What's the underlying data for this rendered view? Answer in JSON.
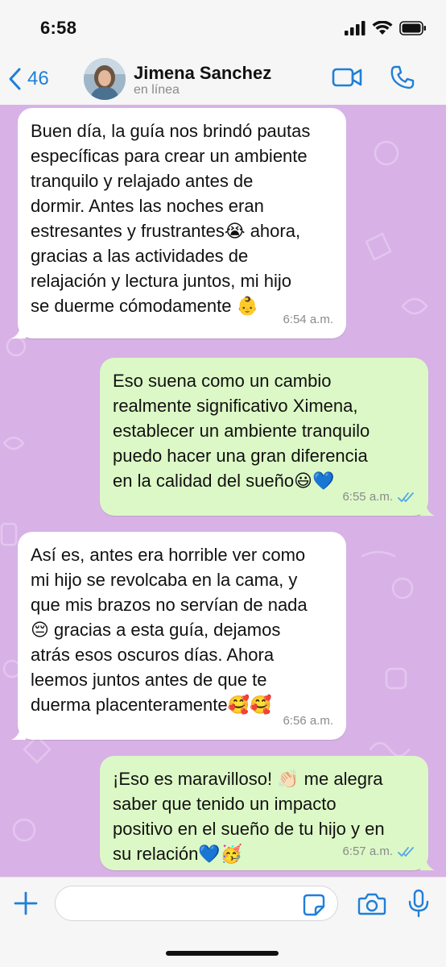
{
  "status_bar": {
    "time": "6:58"
  },
  "header": {
    "back_count": "46",
    "contact_name": "Jimena Sanchez",
    "contact_status": "en línea"
  },
  "messages": [
    {
      "direction": "incoming",
      "text": "Buen día, la guía nos brindó pautas\nespecíficas para crear un ambiente\ntranquilo y relajado antes de\ndormir. Antes las noches eran\nestresantes y frustrantes😭 ahora,\ngracias a las actividades de\nrelajación y lectura juntos, mi hijo\nse duerme cómodamente 👶",
      "time": "6:54 a.m."
    },
    {
      "direction": "outgoing",
      "text": "Eso suena como un cambio\nrealmente significativo Ximena,\nestablecer un ambiente tranquilo\npuedo hacer una gran diferencia\nen la calidad del sueño😃💙",
      "time": "6:55 a.m.",
      "status": "read"
    },
    {
      "direction": "incoming",
      "text": "Así es, antes era horrible ver como\nmi hijo se revolcaba en la cama, y\nque mis brazos no servían de nada\n😔 gracias a esta guía, dejamos\natrás esos oscuros días. Ahora\nleemos juntos antes de que te\nduerma placenteramente🥰🥰",
      "time": "6:56 a.m."
    },
    {
      "direction": "outgoing",
      "text": "¡Eso es maravilloso! 👏🏻 me alegra\nsaber que tenido un impacto\npositivo en el sueño de tu hijo y en\nsu relación💙🥳",
      "time": "6:57 a.m.",
      "status": "read"
    }
  ],
  "input": {
    "value": "",
    "placeholder": ""
  },
  "colors": {
    "accent": "#1f7fd8",
    "chat_background": "#d8b2e6",
    "incoming_bubble": "#ffffff",
    "outgoing_bubble": "#dcf8c6",
    "read_ticks": "#53a6e8"
  },
  "icons": {
    "back": "chevron-left-icon",
    "video": "video-camera-icon",
    "call": "phone-icon",
    "plus": "plus-icon",
    "sticker": "sticker-icon",
    "camera": "camera-icon",
    "mic": "microphone-icon",
    "read": "double-check-icon"
  }
}
